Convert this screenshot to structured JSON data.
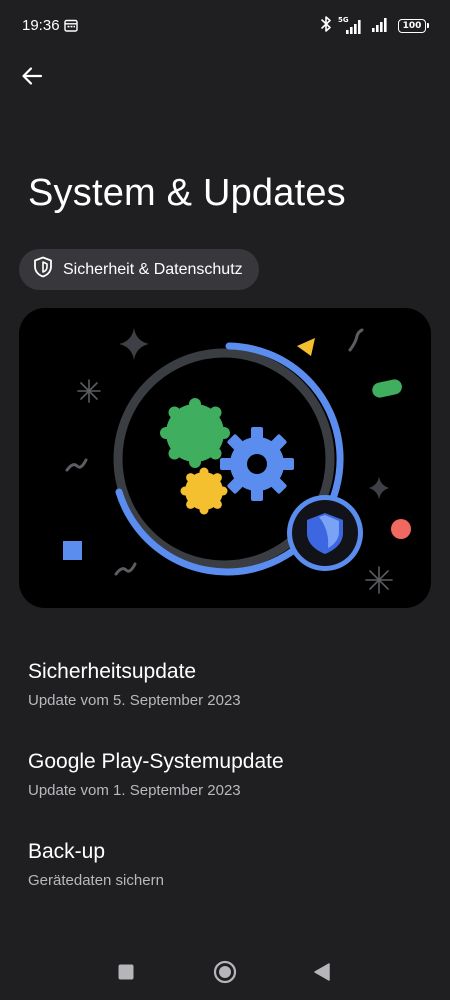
{
  "status_bar": {
    "time": "19:36",
    "network_label": "5G",
    "battery": "100",
    "icons": [
      "calendar-icon",
      "bluetooth-icon",
      "signal-icon",
      "battery-icon"
    ]
  },
  "header": {
    "back_icon": "arrow-left-icon",
    "title": "System & Updates"
  },
  "chip": {
    "icon": "shield-icon",
    "label": "Sicherheit & Datenschutz"
  },
  "banner": {
    "illustration": "system-update-illustration",
    "colors": {
      "blue": "#5b8def",
      "green": "#3fae5f",
      "yellow": "#f5c030",
      "red": "#f0685f",
      "ring": "#3a3d42"
    }
  },
  "items": [
    {
      "title": "Sicherheitsupdate",
      "subtitle": "Update vom 5. September 2023"
    },
    {
      "title": "Google Play-Systemupdate",
      "subtitle": "Update vom 1. September 2023"
    },
    {
      "title": "Back-up",
      "subtitle": "Gerätedaten sichern"
    }
  ],
  "nav_bar": {
    "icons": [
      "recents-square-icon",
      "home-circle-icon",
      "back-triangle-icon"
    ]
  },
  "colors": {
    "background": "#1f1f22",
    "chip_background": "#38383c",
    "subtitle_text": "#b8b8bd"
  }
}
